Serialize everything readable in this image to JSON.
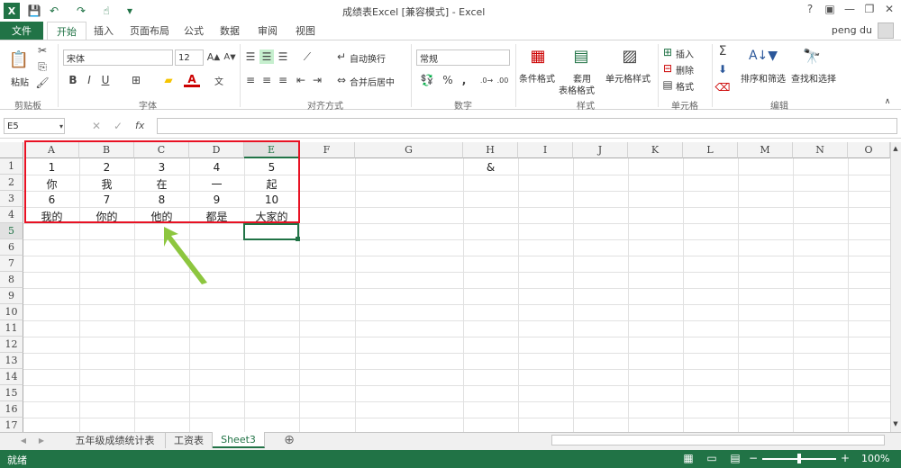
{
  "title": "成绩表Excel  [兼容模式] - Excel",
  "user": "peng du",
  "tabs": [
    "文件",
    "开始",
    "插入",
    "页面布局",
    "公式",
    "数据",
    "审阅",
    "视图"
  ],
  "ribbon": {
    "clipboard": {
      "paste": "粘贴",
      "label": "剪贴板"
    },
    "font": {
      "name": "宋体",
      "size": "12",
      "label": "字体",
      "bold": "B",
      "italic": "I",
      "underline": "U"
    },
    "alignment": {
      "wrap": "自动换行",
      "merge": "合并后居中",
      "label": "对齐方式"
    },
    "number": {
      "format": "常规",
      "label": "数字",
      "percent": "%",
      "comma": ","
    },
    "styles": {
      "conditional": "条件格式",
      "table_format_1": "套用",
      "table_format_2": "表格格式",
      "cell_styles": "单元格样式",
      "label": "样式"
    },
    "cells": {
      "insert": "插入",
      "delete": "删除",
      "format": "格式",
      "label": "单元格"
    },
    "editing": {
      "sort": "排序和筛选",
      "find": "查找和选择",
      "label": "编辑",
      "sum": "Σ"
    }
  },
  "formula_bar": {
    "name_box": "E5",
    "fx": "fx",
    "content": ""
  },
  "columns": [
    "A",
    "B",
    "C",
    "D",
    "E",
    "F",
    "G",
    "H",
    "I",
    "J",
    "K",
    "L",
    "M",
    "N",
    "O"
  ],
  "rows": [
    "1",
    "2",
    "3",
    "4",
    "5",
    "6",
    "7",
    "8",
    "9",
    "10",
    "11",
    "12",
    "13",
    "14",
    "15",
    "16",
    "17"
  ],
  "cells": {
    "row1": [
      "1",
      "2",
      "3",
      "4",
      "5"
    ],
    "row2": [
      "你",
      "我",
      "在",
      "一",
      "起"
    ],
    "row3": [
      "6",
      "7",
      "8",
      "9",
      "10"
    ],
    "row4": [
      "我的",
      "你的",
      "他的",
      "都是",
      "大家的"
    ],
    "H1": "&"
  },
  "sheets": [
    "五年级成绩统计表",
    "工资表",
    "Sheet3"
  ],
  "add_sheet": "⊕",
  "status": {
    "ready": "就绪",
    "zoom": "100%"
  },
  "accent": "#217346",
  "highlight": "#e81123",
  "arrow_color": "#8dc63f"
}
